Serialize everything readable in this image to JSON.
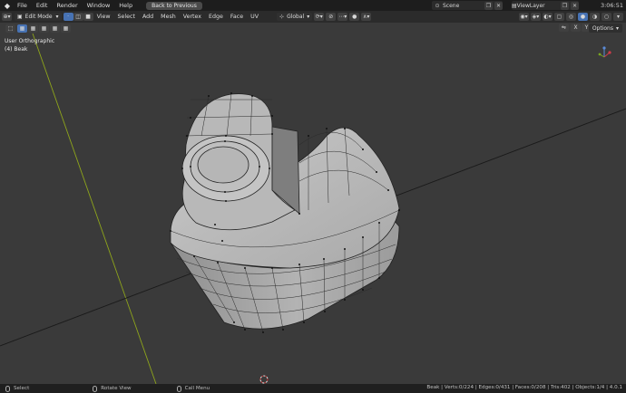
{
  "app": {
    "name": "Blender"
  },
  "topbar": {
    "menus": [
      "File",
      "Edit",
      "Render",
      "Window",
      "Help"
    ],
    "back_button": "Back to Previous",
    "scene": "Scene",
    "view_layer": "ViewLayer",
    "time": "3:06:51"
  },
  "toolbar": {
    "mode": "Edit Mode",
    "menus": [
      "View",
      "Select",
      "Add",
      "Mesh",
      "Vertex",
      "Edge",
      "Face",
      "UV"
    ],
    "transform_orientation": "Global"
  },
  "subbar": {
    "axes": [
      "X",
      "Y",
      "Z"
    ],
    "options": "Options"
  },
  "viewport": {
    "view_name": "User Orthographic",
    "object_label": "(4) Beak"
  },
  "statusbar": {
    "select": "Select",
    "rotate": "Rotate View",
    "call_menu": "Call Menu",
    "stats": "Beak | Verts:0/224 | Edges:0/431 | Faces:0/208 | Tris:402 | Objects:1/4 | 4.0.1"
  },
  "colors": {
    "active_blue": "#4772b3",
    "viewport_bg": "#3a3a3a",
    "mesh_fill": "#a7a7a7"
  }
}
